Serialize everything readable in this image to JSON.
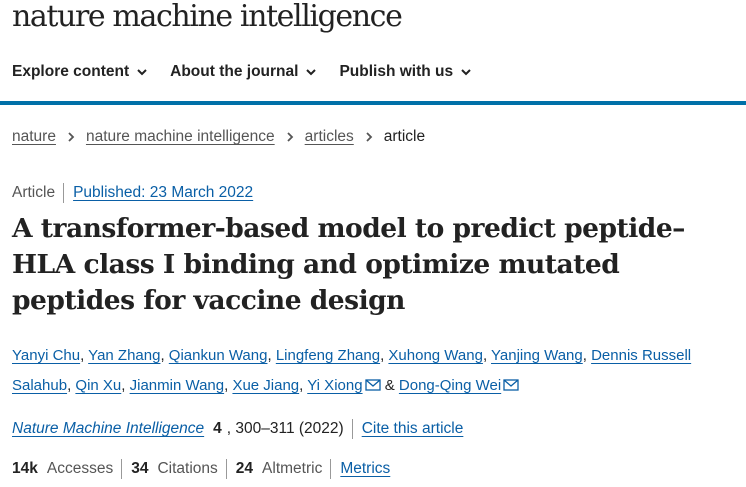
{
  "brand": {
    "name": "nature machine intelligence"
  },
  "nav": {
    "items": [
      {
        "label": "Explore content",
        "icon": "chevron-down-icon"
      },
      {
        "label": "About the journal",
        "icon": "chevron-down-icon"
      },
      {
        "label": "Publish with us",
        "icon": "chevron-down-icon"
      }
    ]
  },
  "colors": {
    "accent": "#0070a8",
    "link": "#0a5fa6"
  },
  "breadcrumb": {
    "items": [
      "nature",
      "nature machine intelligence",
      "articles"
    ],
    "current": "article"
  },
  "article": {
    "type": "Article",
    "published": "Published: 23 March 2022",
    "title": "A transformer-based model to predict peptide–HLA class I binding and optimize mutated peptides for vaccine design",
    "authors": [
      "Yanyi Chu",
      "Yan Zhang",
      "Qiankun Wang",
      "Lingfeng Zhang",
      "Xuhong Wang",
      "Yanjing Wang",
      "Dennis Russell Salahub",
      "Qin Xu",
      "Jianmin Wang",
      "Xue Jiang",
      "Yi Xiong",
      "Dong-Qing Wei"
    ],
    "author_separator": ", ",
    "author_conjunction": "&",
    "citation": {
      "journal": "Nature Machine Intelligence",
      "volume": "4",
      "pages": ", 300–311 (2022)",
      "cite_link": "Cite this article"
    },
    "metrics": {
      "accesses_value": "14k",
      "accesses_label": "Accesses",
      "citations_value": "34",
      "citations_label": "Citations",
      "altmetric_value": "24",
      "altmetric_label": "Altmetric",
      "metrics_link": "Metrics"
    }
  }
}
